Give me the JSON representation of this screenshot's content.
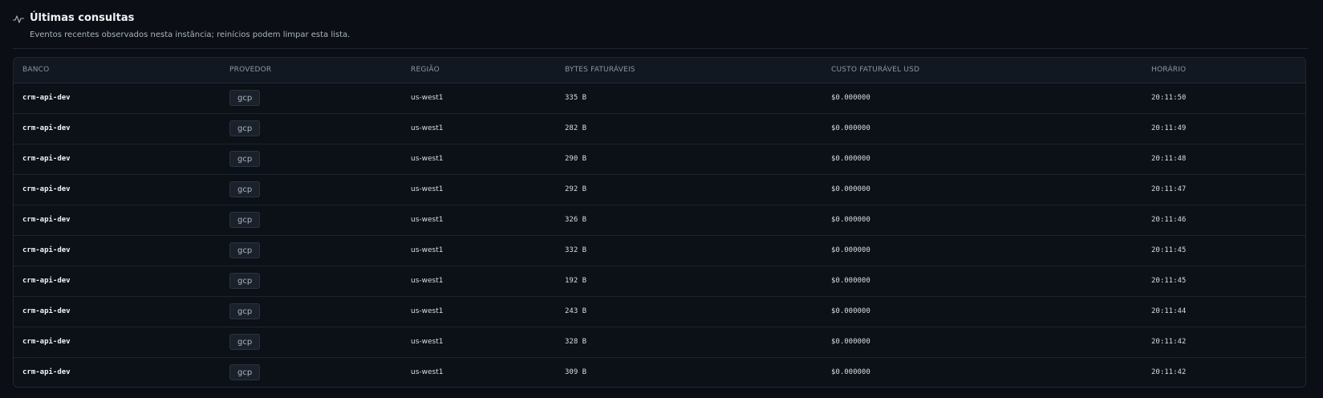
{
  "header": {
    "icon": "activity-icon",
    "title": "Últimas consultas",
    "subtitle": "Eventos recentes observados nesta instância; reinícios podem limpar esta lista."
  },
  "table": {
    "columns": [
      "BANCO",
      "PROVEDOR",
      "REGIÃO",
      "BYTES FATURÁVEIS",
      "CUSTO FATURÁVEL USD",
      "HORÁRIO"
    ],
    "rows": [
      {
        "banco": "crm-api-dev",
        "provedor": "gcp",
        "regiao": "us-west1",
        "bytes": "335 B",
        "custo": "$0.000000",
        "horario": "20:11:50"
      },
      {
        "banco": "crm-api-dev",
        "provedor": "gcp",
        "regiao": "us-west1",
        "bytes": "282 B",
        "custo": "$0.000000",
        "horario": "20:11:49"
      },
      {
        "banco": "crm-api-dev",
        "provedor": "gcp",
        "regiao": "us-west1",
        "bytes": "290 B",
        "custo": "$0.000000",
        "horario": "20:11:48"
      },
      {
        "banco": "crm-api-dev",
        "provedor": "gcp",
        "regiao": "us-west1",
        "bytes": "292 B",
        "custo": "$0.000000",
        "horario": "20:11:47"
      },
      {
        "banco": "crm-api-dev",
        "provedor": "gcp",
        "regiao": "us-west1",
        "bytes": "326 B",
        "custo": "$0.000000",
        "horario": "20:11:46"
      },
      {
        "banco": "crm-api-dev",
        "provedor": "gcp",
        "regiao": "us-west1",
        "bytes": "332 B",
        "custo": "$0.000000",
        "horario": "20:11:45"
      },
      {
        "banco": "crm-api-dev",
        "provedor": "gcp",
        "regiao": "us-west1",
        "bytes": "192 B",
        "custo": "$0.000000",
        "horario": "20:11:45"
      },
      {
        "banco": "crm-api-dev",
        "provedor": "gcp",
        "regiao": "us-west1",
        "bytes": "243 B",
        "custo": "$0.000000",
        "horario": "20:11:44"
      },
      {
        "banco": "crm-api-dev",
        "provedor": "gcp",
        "regiao": "us-west1",
        "bytes": "328 B",
        "custo": "$0.000000",
        "horario": "20:11:42"
      },
      {
        "banco": "crm-api-dev",
        "provedor": "gcp",
        "regiao": "us-west1",
        "bytes": "309 B",
        "custo": "$0.000000",
        "horario": "20:11:42"
      }
    ]
  }
}
